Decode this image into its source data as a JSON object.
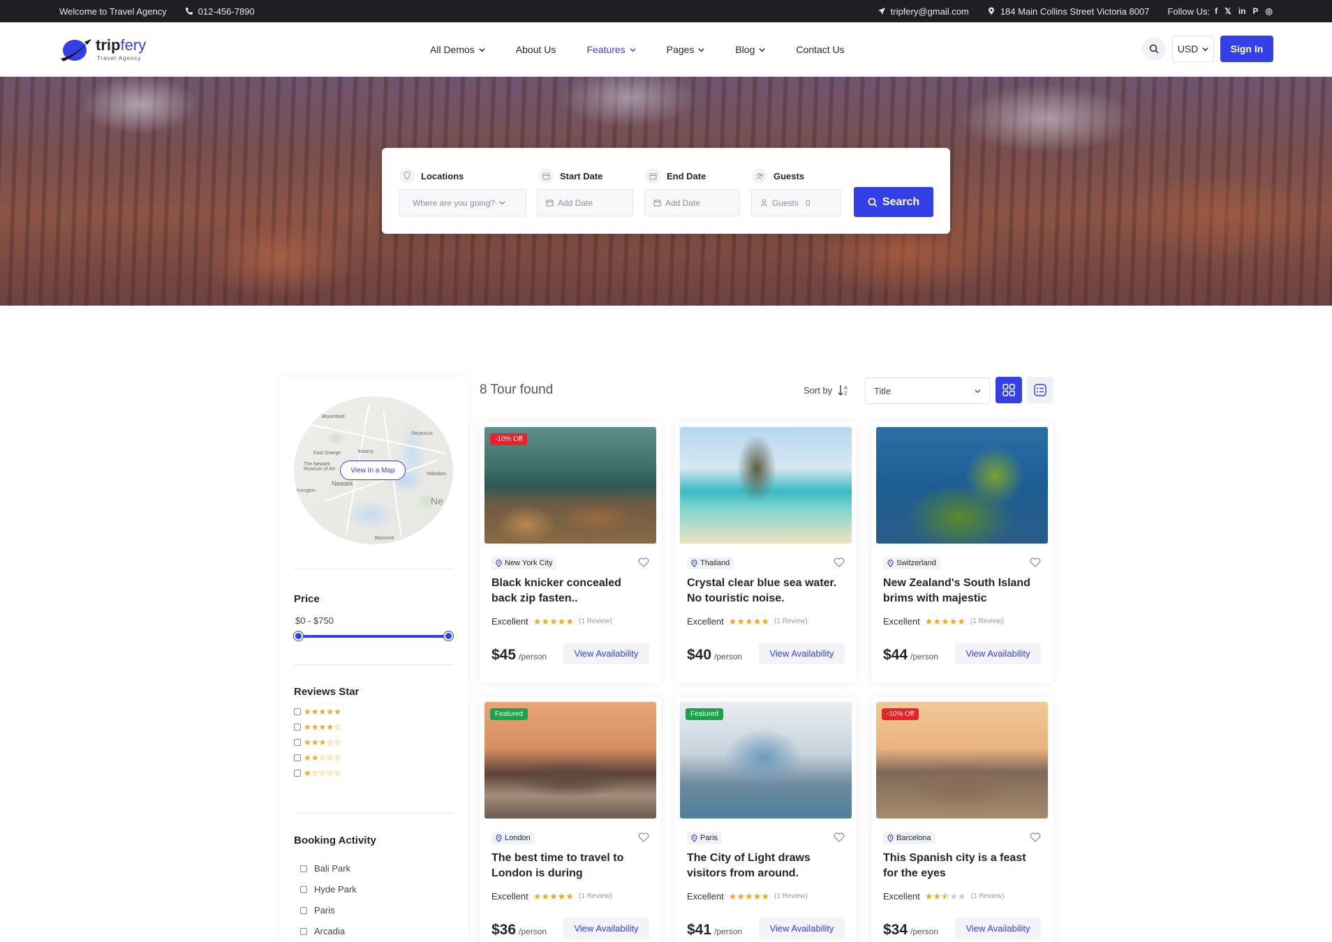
{
  "topbar": {
    "welcome": "Welcome to Travel Agency",
    "phone": "012-456-7890",
    "email": "tripfery@gmail.com",
    "address": "184 Main Collins Street Victoria 8007",
    "follow_label": "Follow Us:",
    "socials": [
      "f",
      "𝕏",
      "in",
      "P",
      "◎"
    ]
  },
  "logo": {
    "brand_a": "trip",
    "brand_b": "fery",
    "tagline": "Travel Agency"
  },
  "nav": {
    "items": [
      {
        "label": "All Demos",
        "dropdown": true,
        "active": false
      },
      {
        "label": "About Us",
        "dropdown": false,
        "active": false
      },
      {
        "label": "Features",
        "dropdown": true,
        "active": true
      },
      {
        "label": "Pages",
        "dropdown": true,
        "active": false
      },
      {
        "label": "Blog",
        "dropdown": true,
        "active": false
      },
      {
        "label": "Contact Us",
        "dropdown": false,
        "active": false
      }
    ],
    "currency": "USD",
    "signin": "Sign In"
  },
  "search": {
    "locations_label": "Locations",
    "locations_placeholder": "Where are you going?",
    "start_label": "Start Date",
    "start_placeholder": "Add Date",
    "end_label": "End Date",
    "end_placeholder": "Add Date",
    "guests_label": "Guests",
    "guests_placeholder": "Guests",
    "guests_value": "0",
    "button": "Search"
  },
  "sidebar": {
    "map_button": "View In a Map",
    "map_labels": [
      "Bloomfield",
      "East Orange",
      "The Newark Museum of Art",
      "Newark",
      "Hoboken",
      "Secaucus",
      "Kearny",
      "Irvington",
      "Bayonne",
      "Ne"
    ],
    "price_heading": "Price",
    "price_range": "$0 - $750",
    "reviews_heading": "Reviews Star",
    "star_options": [
      5,
      4,
      3,
      2,
      1
    ],
    "activity_heading": "Booking Activity",
    "activities": [
      "Bali Park",
      "Hyde Park",
      "Paris",
      "Arcadia"
    ]
  },
  "results": {
    "found": "8 Tour found",
    "sort_label": "Sort by",
    "sort_value": "Title"
  },
  "tours": [
    {
      "badge": "-10% Off",
      "badge_type": "red",
      "location": "New York City",
      "title": "Black knicker concealed back zip fasten..",
      "rating_label": "Excellent",
      "stars": 5,
      "reviews": "(1 Review)",
      "price": "$45",
      "per": "/person",
      "cta": "View Availability",
      "scene": "alps"
    },
    {
      "badge": "",
      "badge_type": "",
      "location": "Thailand",
      "title": "Crystal clear blue sea water. No touristic noise.",
      "rating_label": "Excellent",
      "stars": 5,
      "reviews": "(1 Review)",
      "price": "$40",
      "per": "/person",
      "cta": "View Availability",
      "scene": "beach"
    },
    {
      "badge": "",
      "badge_type": "",
      "location": "Switzerland",
      "title": "New Zealand's South Island brims with majestic",
      "rating_label": "Excellent",
      "stars": 5,
      "reviews": "(1 Review)",
      "price": "$44",
      "per": "/person",
      "cta": "View Availability",
      "scene": "cliff"
    },
    {
      "badge": "Featured",
      "badge_type": "green",
      "location": "London",
      "title": "The best time to travel to London is during",
      "rating_label": "Excellent",
      "stars": 5,
      "reviews": "(1 Review)",
      "price": "$36",
      "per": "/person",
      "cta": "View Availability",
      "scene": "london"
    },
    {
      "badge": "Featured",
      "badge_type": "green",
      "location": "Paris",
      "title": "The City of Light draws visitors from around.",
      "rating_label": "Excellent",
      "stars": 5,
      "reviews": "(1 Review)",
      "price": "$41",
      "per": "/person",
      "cta": "View Availability",
      "scene": "paris"
    },
    {
      "badge": "-10% Off",
      "badge_type": "red",
      "location": "Barcelona",
      "title": "This Spanish city is a feast for the eyes",
      "rating_label": "Excellent",
      "stars": 2.5,
      "reviews": "(1 Review)",
      "price": "$34",
      "per": "/person",
      "cta": "View Availability",
      "scene": "barcelona"
    }
  ],
  "colors": {
    "primary": "#3340e6",
    "star": "#f2a71b",
    "topbar": "#1e1f24"
  }
}
